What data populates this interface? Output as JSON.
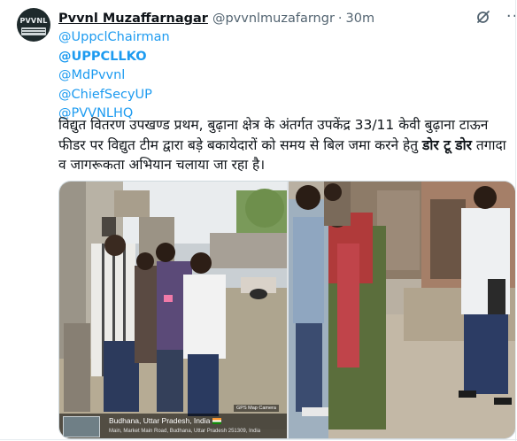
{
  "tweet": {
    "display_name": "Pvvnl Muzaffarnagar",
    "handle": "@pvvnlmuzafarngr",
    "separator": "·",
    "time": "30m",
    "avatar_logo_text": "PVVNL",
    "icons": {
      "grok": "grok-icon",
      "more": "more-options-icon"
    },
    "more_label": "···",
    "mentions": [
      "@UppclChairman",
      "@UPPCLLKO",
      "@MdPvvnl",
      "@ChiefSecyUP",
      "@PVVNLHQ"
    ],
    "text_before": "विद्युत वितरण उपखण्ड प्रथम, बुढ़ाना क्षेत्र के अंतर्गत उपकेंद्र 33/11 केवी बुढ़ाना टाऊन फीडर पर विद्युत टीम द्वारा बड़े बकायेदारों को समय से बिल जमा करने हेतु ",
    "text_bold": "डोर टू डोर",
    "text_after": " तगादा व जागरूकता अभियान चलाया जा रहा है।"
  },
  "media": {
    "photo_left": {
      "gps_badge": "GPS Map Camera",
      "gps_title": "Budhana, Uttar Pradesh, India",
      "gps_address": "Main, Market Main Road, Budhana, Uttar Pradesh 251309, India"
    }
  }
}
